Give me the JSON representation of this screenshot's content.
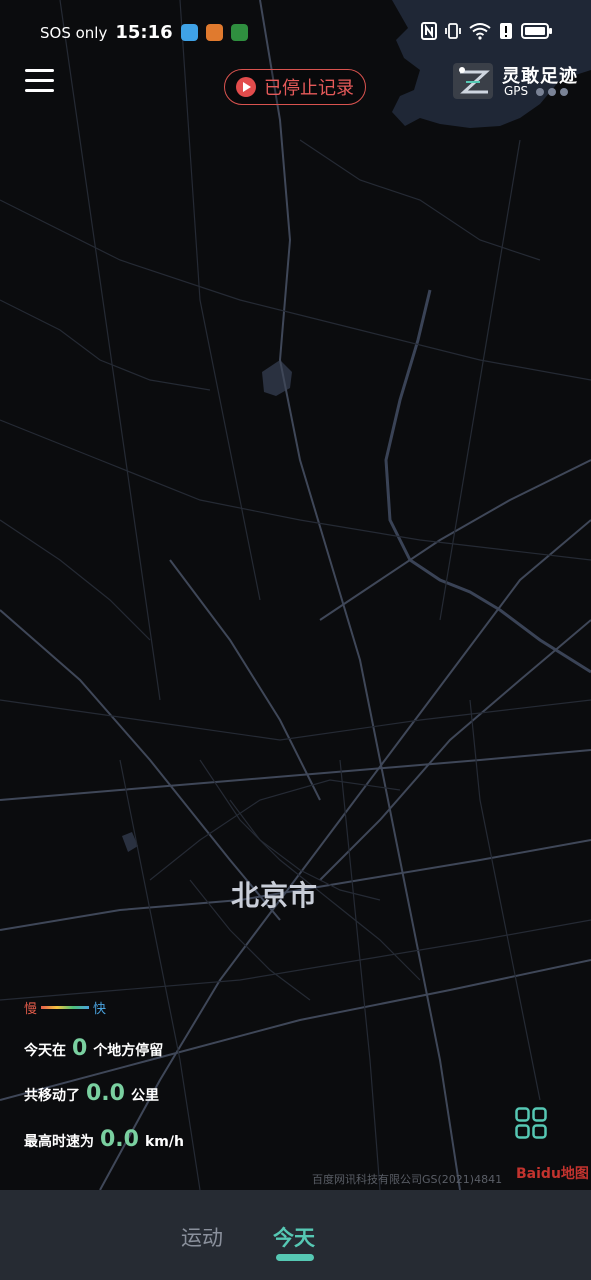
{
  "status_bar": {
    "carrier": "SOS only",
    "time": "15:16"
  },
  "header": {
    "record_status": "已停止记录",
    "logo_text": "灵敢足迹",
    "logo_gps": "GPS"
  },
  "map": {
    "city_label": "北京市",
    "copyright": "百度网讯科技有限公司GS(2021)4841",
    "provider": "Baidu地图"
  },
  "legend": {
    "slow": "慢",
    "fast": "快"
  },
  "stats": {
    "stay_prefix": "今天在",
    "stay_count": "0",
    "stay_suffix": "个地方停留",
    "distance_prefix": "共移动了",
    "distance_value": "0.0",
    "distance_unit": "公里",
    "speed_prefix": "最高时速为",
    "speed_value": "0.0",
    "speed_unit": "km/h"
  },
  "tabs": [
    {
      "label": "运动",
      "active": false
    },
    {
      "label": "今天",
      "active": true
    }
  ],
  "colors": {
    "accent": "#56c8b4",
    "record": "#e65a5a",
    "stat_number": "#7ad0a0"
  }
}
